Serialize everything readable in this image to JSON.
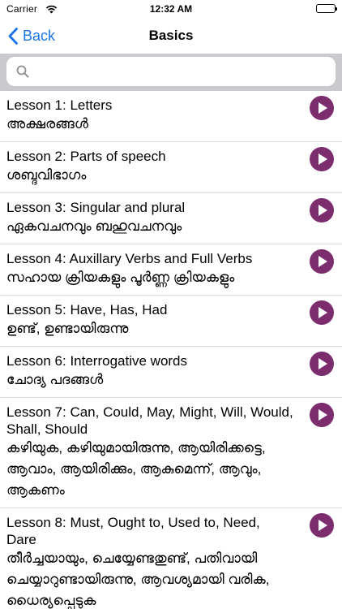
{
  "status_bar": {
    "carrier": "Carrier",
    "time": "12:32 AM"
  },
  "nav": {
    "back_label": "Back",
    "title": "Basics"
  },
  "search": {
    "placeholder": ""
  },
  "colors": {
    "accent": "#1a73e8",
    "play_button": "#7b2d6e",
    "search_bg": "#c9c9ce"
  },
  "icons": {
    "back": "chevron-left-icon",
    "search": "search-icon",
    "play": "play-icon",
    "wifi": "wifi-icon",
    "battery": "battery-icon"
  },
  "lessons": [
    {
      "title": "Lesson 1: Letters",
      "subtitle": "അക്ഷരങ്ങൾ"
    },
    {
      "title": "Lesson 2: Parts of speech",
      "subtitle": "ശബ്ദവിഭാഗം"
    },
    {
      "title": "Lesson 3: Singular and plural",
      "subtitle": "ഏകവചനവും ബഹുവചനവും"
    },
    {
      "title": "Lesson 4: Auxillary Verbs and Full Verbs",
      "subtitle": "സഹായ ക്രിയകളും പൂർണ്ണ ക്രിയകളും"
    },
    {
      "title": "Lesson 5: Have, Has, Had",
      "subtitle": "ഉണ്ട്, ഉണ്ടായിരുന്നു"
    },
    {
      "title": "Lesson 6: Interrogative words",
      "subtitle": "ചോദ്യ പദങ്ങൾ"
    },
    {
      "title": "Lesson 7: Can, Could, May, Might, Will, Would, Shall, Should",
      "subtitle": "കഴിയുക, കഴിയുമായിരുന്നു, ആയിരിക്കട്ടെ, ആവാം, ആയിരിക്കും, ആകുമെന്ന്, ആവും, ആകണം"
    },
    {
      "title": "Lesson 8: Must, Ought to, Used to, Need, Dare",
      "subtitle": "തീർച്ചയായും, ചെയ്യേണ്ടതുണ്ട്, പതിവായി ചെയ്യാറുണ്ടായിരുന്നു, ആവശ്യമായി വരിക, ധൈര്യപ്പെടുക"
    }
  ]
}
